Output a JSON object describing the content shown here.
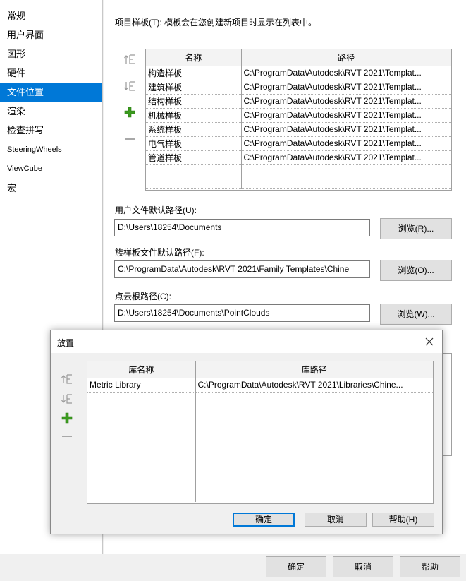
{
  "sidebar": {
    "items": [
      {
        "label": "常规"
      },
      {
        "label": "用户界面"
      },
      {
        "label": "图形"
      },
      {
        "label": "硬件"
      },
      {
        "label": "文件位置"
      },
      {
        "label": "渲染"
      },
      {
        "label": "检查拼写"
      },
      {
        "label": "SteeringWheels"
      },
      {
        "label": "ViewCube"
      },
      {
        "label": "宏"
      }
    ],
    "selected": "文件位置"
  },
  "project_templates": {
    "heading": "项目样板(T): 模板会在您创建新项目时显示在列表中。",
    "columns": [
      "名称",
      "路径"
    ],
    "rows": [
      [
        "构造样板",
        "C:\\ProgramData\\Autodesk\\RVT 2021\\Templat..."
      ],
      [
        "建筑样板",
        "C:\\ProgramData\\Autodesk\\RVT 2021\\Templat..."
      ],
      [
        "结构样板",
        "C:\\ProgramData\\Autodesk\\RVT 2021\\Templat..."
      ],
      [
        "机械样板",
        "C:\\ProgramData\\Autodesk\\RVT 2021\\Templat..."
      ],
      [
        "系统样板",
        "C:\\ProgramData\\Autodesk\\RVT 2021\\Templat..."
      ],
      [
        "电气样板",
        "C:\\ProgramData\\Autodesk\\RVT 2021\\Templat..."
      ],
      [
        "管道样板",
        "C:\\ProgramData\\Autodesk\\RVT 2021\\Templat..."
      ]
    ]
  },
  "user_path": {
    "label": "用户文件默认路径(U):",
    "value": "D:\\Users\\18254\\Documents",
    "browse": "浏览(R)..."
  },
  "family_path": {
    "label": "族样板文件默认路径(F):",
    "value": "C:\\ProgramData\\Autodesk\\RVT 2021\\Family Templates\\Chine",
    "browse": "浏览(O)..."
  },
  "pointcloud_path": {
    "label": "点云根路径(C):",
    "value": "D:\\Users\\18254\\Documents\\PointClouds",
    "browse": "浏览(W)..."
  },
  "footer": {
    "ok": "确定",
    "cancel": "取消",
    "help": "帮助"
  },
  "dialog": {
    "title": "放置",
    "columns": [
      "库名称",
      "库路径"
    ],
    "rows": [
      [
        "Metric Library",
        "C:\\ProgramData\\Autodesk\\RVT 2021\\Libraries\\Chine..."
      ]
    ],
    "ok": "确定",
    "cancel": "取消",
    "help": "帮助(H)"
  },
  "colors": {
    "accent": "#0078d7",
    "add_icon": "#3a9a1e"
  },
  "icons": [
    "move-up-icon",
    "move-down-icon",
    "add-icon",
    "remove-icon",
    "close-icon"
  ]
}
